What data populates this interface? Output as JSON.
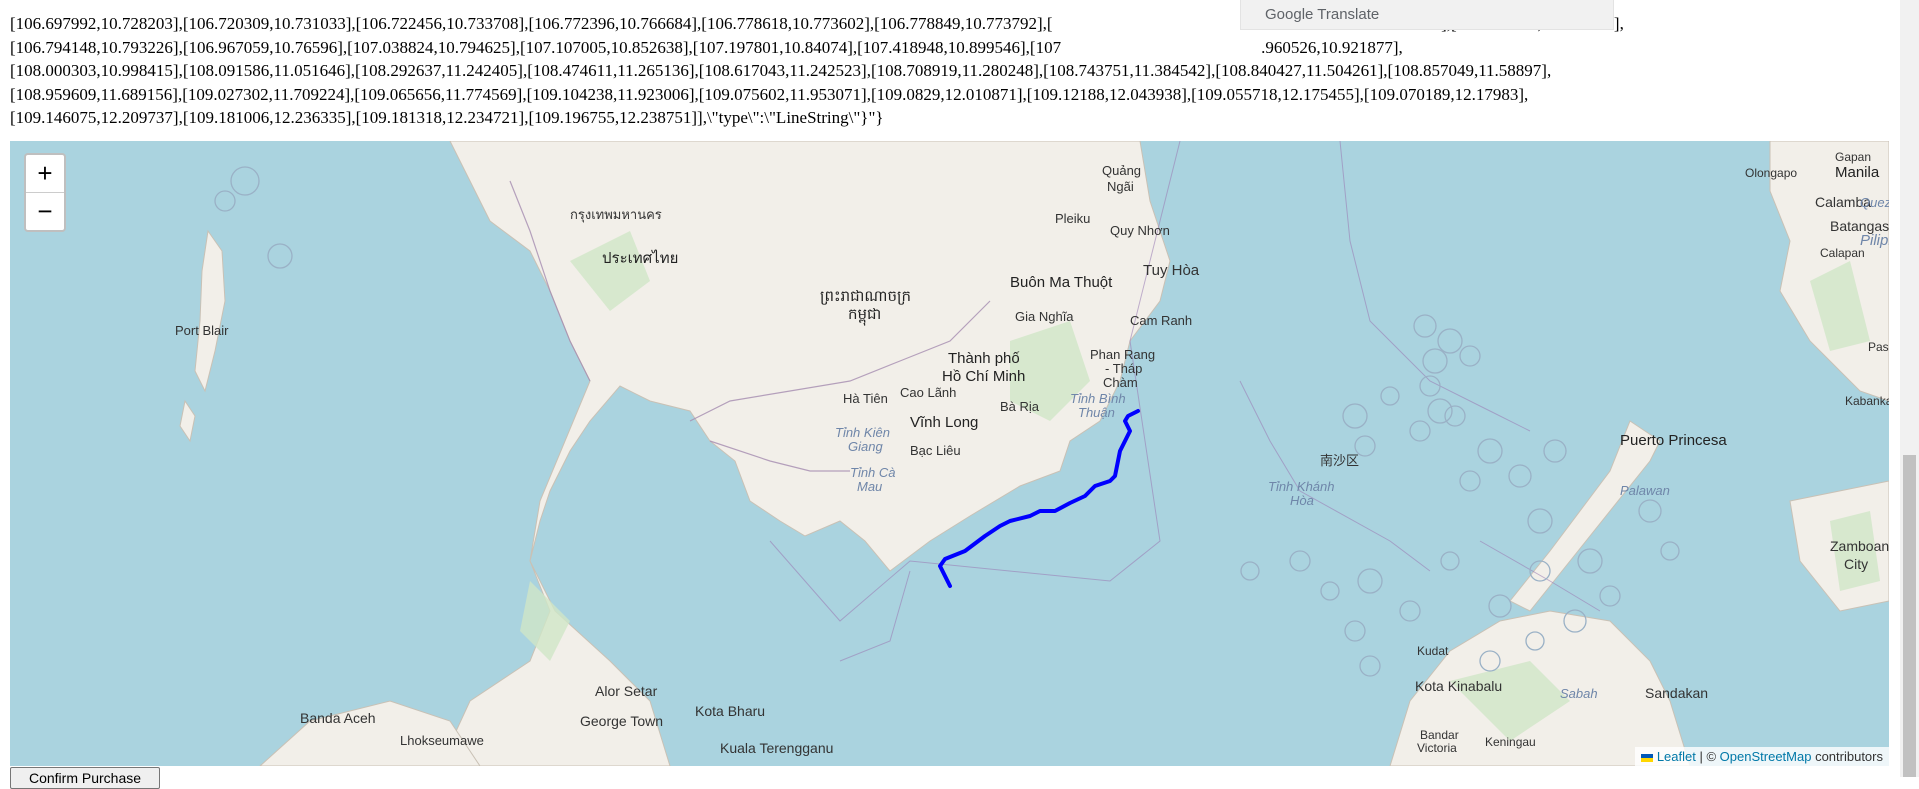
{
  "geojson_lines": [
    "[106.697992,10.728203],[106.720309,10.731033],[106.722456,10.733708],[106.772396,10.766684],[106.778618,10.773602],[106.778849,10.773792],[",
    "[106.794148,10.793226],[106.967059,10.76596],[107.038824,10.794625],[107.107005,10.852638],[107.197801,10.84074],[107.418948,10.899546],[107",
    "[108.000303,10.998415],[108.091586,11.051646],[108.292637,11.242405],[108.474611,11.265136],[108.617043,11.242523],[108.708919,11.280248],[108.743751,11.384542],[108.840427,11.504261],[108.857049,11.58897],",
    "[108.959609,11.689156],[109.027302,11.709224],[109.065656,11.774569],[109.104238,11.923006],[109.075602,11.953071],[109.0829,12.010871],[109.12188,12.043938],[109.055718,12.175455],[109.070189,12.17983],",
    "[109.146075,12.209737],[109.181006,12.236335],[109.181318,12.234721],[109.196755,12.238751]],\\\"type\\\":\\\"LineString\\\"}\"}"
  ],
  "geojson_line_right_1": "3],[106.792745,10.792498],",
  "geojson_line_right_2": ".960526,10.921877],",
  "google_translate": "Google Translate",
  "map": {
    "zoom_in": "+",
    "zoom_out": "−",
    "attribution_leaflet": "Leaflet",
    "attribution_sep": " | © ",
    "attribution_osm": "OpenStreetMap",
    "attribution_tail": " contributors",
    "route_color": "#0000ff",
    "labels": {
      "cities": [
        "Quảng Ngãi",
        "Pleiku",
        "Quy Nhơn",
        "Tuy Hòa",
        "Buôn Ma Thuột",
        "Gia Nghĩa",
        "Cam Ranh",
        "Phan Rang - Tháp Chàm",
        "Thành phố Hồ Chí Minh",
        "Cao Lãnh",
        "Hà Tiên",
        "Vĩnh Long",
        "Bà Rịa",
        "Bạc Liêu",
        "Port Blair",
        "Banda Aceh",
        "Lhokseumawe",
        "George Town",
        "Alor Setar",
        "Kota Bharu",
        "Kuala Terengganu",
        "Puerto Princesa",
        "Kota Kinabalu",
        "Sandakan",
        "Bandar Victoria",
        "Keningau",
        "Kudat",
        "Zamboanga City",
        "Olongapo",
        "Manila",
        "Calamba",
        "Batangas City",
        "Calapan",
        "Gapan",
        "Kabankalan",
        "Passi"
      ],
      "seas": [
        "Tỉnh Bình Thuận",
        "Tỉnh Kiên Giang",
        "Tỉnh Cà Mau",
        "Tỉnh Khánh Hòa",
        "Palawan",
        "Sabah",
        "Quezon",
        "Pilipinas"
      ],
      "scripts": [
        "ประเทศไทย",
        "กรุงเทพมหานคร",
        "ព្រះរាជាណាចក្រកម្ពុជា",
        "南沙区"
      ]
    }
  },
  "confirm_button": "Confirm Purchase"
}
